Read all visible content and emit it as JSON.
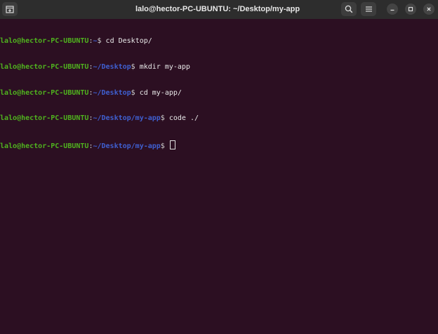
{
  "window": {
    "title": "lalo@hector-PC-UBUNTU: ~/Desktop/my-app",
    "background": "#2c0f22",
    "titlebar_color": "#2d2d2d"
  },
  "titlebar": {
    "new_tab_icon": "new-tab-icon",
    "search_icon": "search-icon",
    "menu_icon": "hamburger-menu-icon",
    "minimize_icon": "minimize-icon",
    "maximize_icon": "maximize-icon",
    "close_icon": "close-icon"
  },
  "terminal": {
    "colors": {
      "user": "#4fb21e",
      "path": "#3f5fd0",
      "text": "#e9e9e9"
    },
    "lines": [
      {
        "user": "lalo@hector-PC-UBUNTU",
        "sep": ":",
        "path": "~",
        "prompt": "$",
        "command": " cd Desktop/"
      },
      {
        "user": "lalo@hector-PC-UBUNTU",
        "sep": ":",
        "path": "~/Desktop",
        "prompt": "$",
        "command": " mkdir my-app"
      },
      {
        "user": "lalo@hector-PC-UBUNTU",
        "sep": ":",
        "path": "~/Desktop",
        "prompt": "$",
        "command": " cd my-app/"
      },
      {
        "user": "lalo@hector-PC-UBUNTU",
        "sep": ":",
        "path": "~/Desktop/my-app",
        "prompt": "$",
        "command": " code ./"
      },
      {
        "user": "lalo@hector-PC-UBUNTU",
        "sep": ":",
        "path": "~/Desktop/my-app",
        "prompt": "$",
        "command": " "
      }
    ]
  }
}
